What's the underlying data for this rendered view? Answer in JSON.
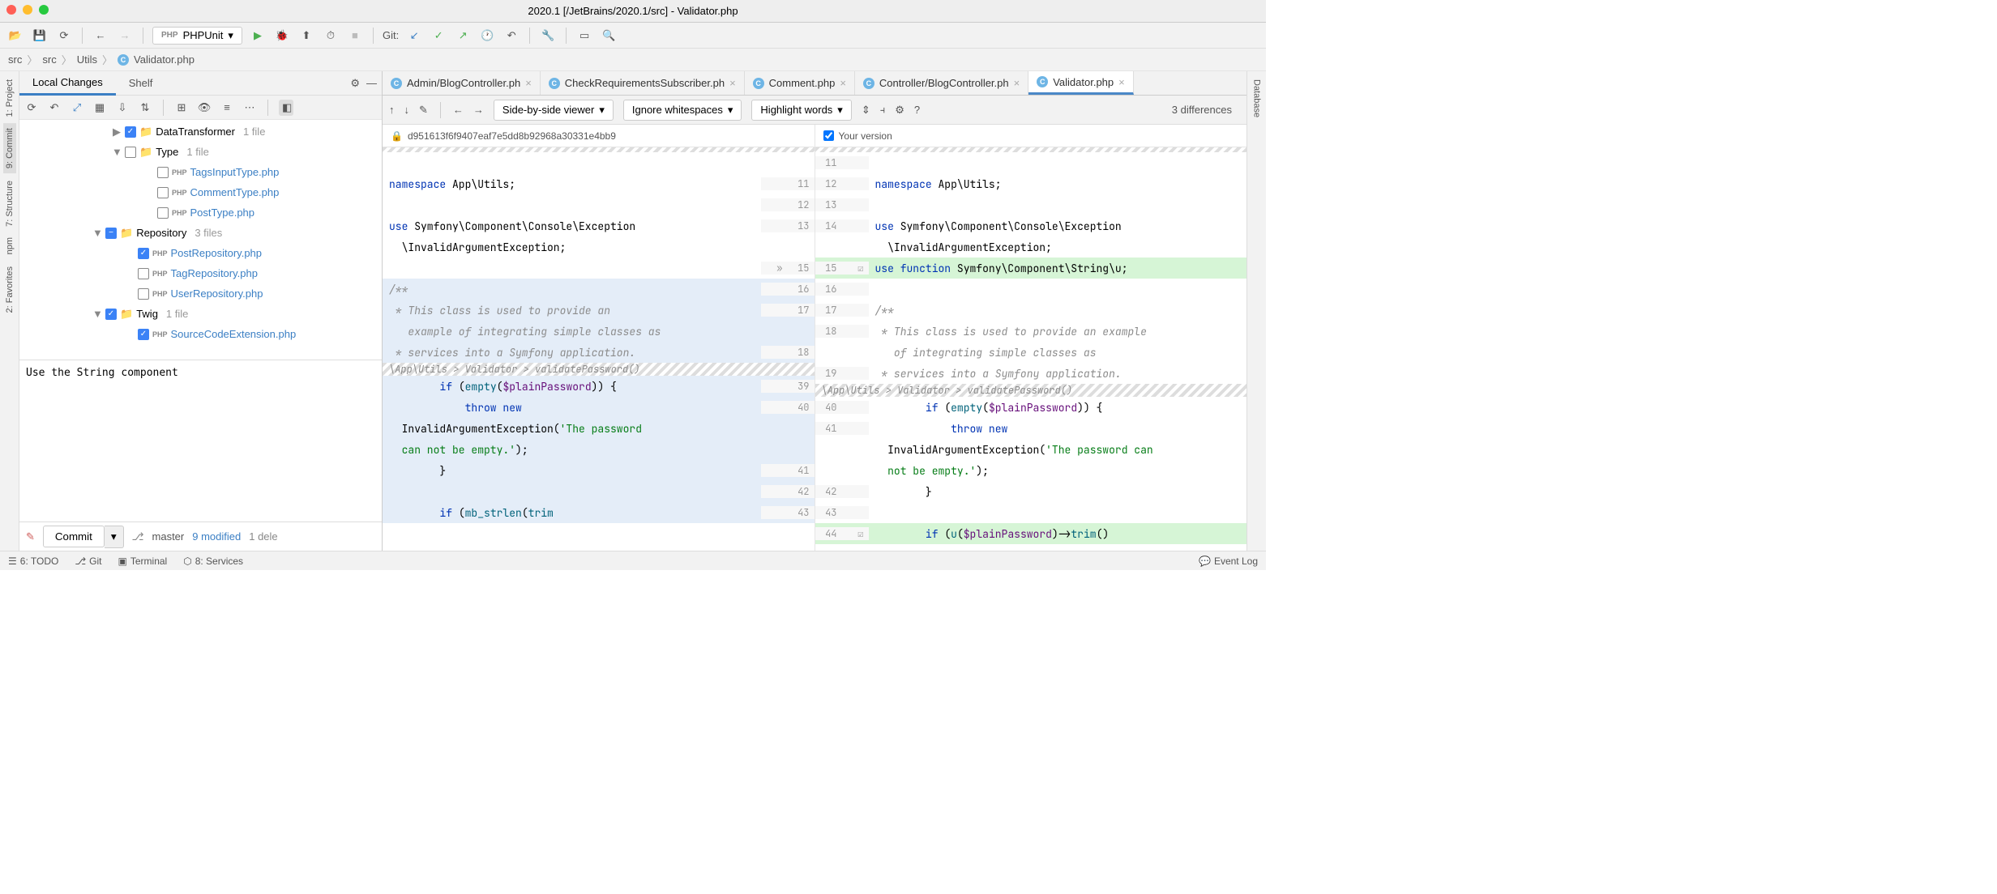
{
  "window": {
    "title": "2020.1 [/JetBrains/2020.1/src] - Validator.php"
  },
  "toolbar": {
    "phpunit": "PHPUnit",
    "git_label": "Git:"
  },
  "breadcrumbs": [
    "src",
    "src",
    "Utils",
    "Validator.php"
  ],
  "leftPanel": {
    "tabs": [
      "Local Changes",
      "Shelf"
    ],
    "tree": [
      {
        "indent": 100,
        "arrow": "▶",
        "check": "ck",
        "folder": true,
        "name": "DataTransformer",
        "meta": "1 file"
      },
      {
        "indent": 100,
        "arrow": "▼",
        "check": "",
        "folder": true,
        "name": "Type",
        "meta": "1 file"
      },
      {
        "indent": 140,
        "arrow": "",
        "check": "",
        "php": true,
        "name": "TagsInputType.php",
        "meta": ""
      },
      {
        "indent": 140,
        "arrow": "",
        "check": "",
        "php": true,
        "name": "CommentType.php",
        "meta": ""
      },
      {
        "indent": 140,
        "arrow": "",
        "check": "",
        "php": true,
        "name": "PostType.php",
        "meta": ""
      },
      {
        "indent": 76,
        "arrow": "▼",
        "check": "half",
        "folder": true,
        "name": "Repository",
        "meta": "3 files"
      },
      {
        "indent": 116,
        "arrow": "",
        "check": "ck",
        "php": true,
        "name": "PostRepository.php",
        "meta": ""
      },
      {
        "indent": 116,
        "arrow": "",
        "check": "",
        "php": true,
        "name": "TagRepository.php",
        "meta": ""
      },
      {
        "indent": 116,
        "arrow": "",
        "check": "",
        "php": true,
        "name": "UserRepository.php",
        "meta": ""
      },
      {
        "indent": 76,
        "arrow": "▼",
        "check": "ck",
        "folder": true,
        "name": "Twig",
        "meta": "1 file"
      },
      {
        "indent": 116,
        "arrow": "",
        "check": "ck",
        "php": true,
        "name": "SourceCodeExtension.php",
        "meta": ""
      }
    ],
    "message": "Use the String component",
    "commit_label": "Commit",
    "branch": "master",
    "modified": "9 modified",
    "deleted": "1 dele"
  },
  "leftRail": [
    "1: Project",
    "9: Commit",
    "7: Structure",
    "npm",
    "2: Favorites"
  ],
  "rightRail": [
    "Database"
  ],
  "editorTabs": [
    {
      "label": "Admin/BlogController.ph",
      "active": false
    },
    {
      "label": "CheckRequirementsSubscriber.ph",
      "active": false
    },
    {
      "label": "Comment.php",
      "active": false
    },
    {
      "label": "Controller/BlogController.ph",
      "active": false
    },
    {
      "label": "Validator.php",
      "active": true
    }
  ],
  "diffToolbar": {
    "viewer": "Side-by-side viewer",
    "whitespace": "Ignore whitespaces",
    "highlight": "Highlight words",
    "count": "3 differences"
  },
  "diffHeader": {
    "left_hash": "d951613f6f9407eaf7e5dd8b92968a30331e4bb9",
    "right_label": "Your version"
  },
  "diffContent": {
    "left": [
      {
        "ln1": "",
        "ln2": "11",
        "cls": "",
        "html": ""
      },
      {
        "ln1": "11",
        "ln2": "12",
        "cls": "",
        "html": "<span class='kw'>namespace</span> App\\Utils;"
      },
      {
        "ln1": "12",
        "ln2": "13",
        "cls": "",
        "html": ""
      },
      {
        "ln1": "13",
        "ln2": "14",
        "cls": "",
        "html": "<span class='kw'>use</span> Symfony\\Component\\Console\\Exception"
      },
      {
        "ln1": "",
        "ln2": "",
        "cls": "",
        "html": "  \\InvalidArgumentException;"
      },
      {
        "ln1": "15",
        "ln2": "",
        "cls": "addedgutter",
        "html": "",
        "marker": "»"
      },
      {
        "ln1": "16",
        "ln2": "",
        "cls": "bluehl",
        "html": "<span class='cmt'>/**</span>"
      },
      {
        "ln1": "17",
        "ln2": "",
        "cls": "bluehl",
        "html": "<span class='cmt'> * This class is used to provide an</span>"
      },
      {
        "ln1": "",
        "ln2": "",
        "cls": "bluehl",
        "html": "<span class='cmt'>   example of integrating simple classes as</span>"
      },
      {
        "ln1": "18",
        "ln2": "",
        "cls": "bluehl",
        "html": "<span class='cmt'> * services into a Symfony application.</span>"
      },
      {
        "bread": "\\App\\Utils > Validator > validatePassword()"
      },
      {
        "ln1": "39",
        "ln2": "",
        "cls": "bluehl",
        "html": "        <span class='kw'>if</span> (<span class='fn'>empty</span>(<span class='var'>$plainPassword</span>)) {"
      },
      {
        "ln1": "40",
        "ln2": "",
        "cls": "bluehl",
        "html": "            <span class='kw'>throw new</span>"
      },
      {
        "ln1": "",
        "ln2": "",
        "cls": "bluehl",
        "html": "  InvalidArgumentException(<span class='str'>'The password</span>"
      },
      {
        "ln1": "",
        "ln2": "",
        "cls": "bluehl",
        "html": "  <span class='str'>can not be empty.'</span>);"
      },
      {
        "ln1": "41",
        "ln2": "",
        "cls": "bluehl",
        "html": "        }"
      },
      {
        "ln1": "42",
        "ln2": "",
        "cls": "bluehl",
        "html": ""
      },
      {
        "ln1": "43",
        "ln2": "",
        "cls": "bluehl",
        "html": "        <span class='kw'>if</span> (<span class='fn'>mb_strlen</span>(<span class='fn'>trim</span>"
      }
    ],
    "right": [
      {
        "ln2": "11",
        "cls": "",
        "html": ""
      },
      {
        "ln2": "12",
        "cls": "",
        "html": "<span class='kw'>namespace</span> App\\Utils;"
      },
      {
        "ln2": "13",
        "cls": "",
        "html": ""
      },
      {
        "ln2": "14",
        "cls": "",
        "html": "<span class='kw'>use</span> Symfony\\Component\\Console\\Exception"
      },
      {
        "ln2": "",
        "cls": "",
        "html": "  \\InvalidArgumentException;"
      },
      {
        "ln2": "15",
        "cls": "added",
        "html": "<span class='kw'>use function</span> Symfony\\Component\\String\\u;",
        "cb": true
      },
      {
        "ln2": "16",
        "cls": "",
        "html": ""
      },
      {
        "ln2": "17",
        "cls": "",
        "html": "<span class='cmt'>/**</span>"
      },
      {
        "ln2": "18",
        "cls": "",
        "html": "<span class='cmt'> * This class is used to provide an example</span>"
      },
      {
        "ln2": "",
        "cls": "",
        "html": "<span class='cmt'>   of integrating simple classes as</span>"
      },
      {
        "ln2": "19",
        "cls": "",
        "html": "<span class='cmt'> * services into a Symfony application.</span>"
      },
      {
        "bread": "\\App\\Utils > Validator > validatePassword()"
      },
      {
        "ln2": "40",
        "cls": "",
        "html": "        <span class='kw'>if</span> (<span class='fn'>empty</span>(<span class='var'>$plainPassword</span>)) {"
      },
      {
        "ln2": "41",
        "cls": "",
        "html": "            <span class='kw'>throw new</span>"
      },
      {
        "ln2": "",
        "cls": "",
        "html": "  InvalidArgumentException(<span class='str'>'The password can</span>"
      },
      {
        "ln2": "",
        "cls": "",
        "html": "  <span class='str'>not be empty.'</span>);"
      },
      {
        "ln2": "42",
        "cls": "",
        "html": "        }"
      },
      {
        "ln2": "43",
        "cls": "",
        "html": ""
      },
      {
        "ln2": "44",
        "cls": "added",
        "html": "        <span class='kw'>if</span> (<span class='fn'>u</span>(<span class='var'>$plainPassword</span>)-&gt;<span class='fn'>trim</span>()",
        "cb": true
      }
    ]
  },
  "statusBar": {
    "todo": "6: TODO",
    "git": "Git",
    "terminal": "Terminal",
    "services": "8: Services",
    "eventlog": "Event Log"
  }
}
